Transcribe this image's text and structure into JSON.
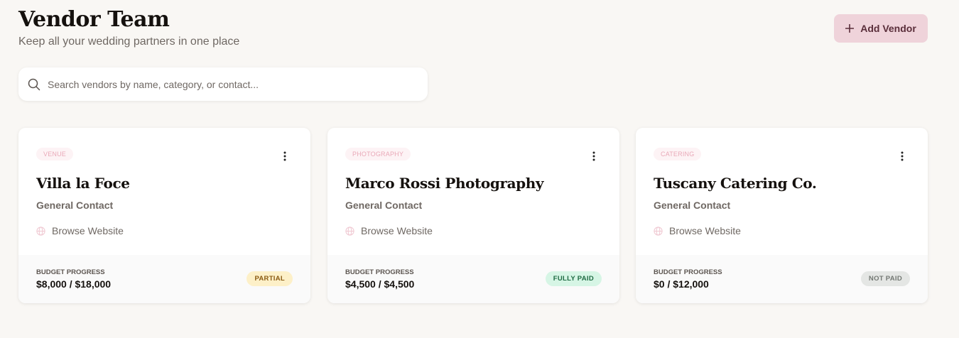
{
  "header": {
    "title": "Vendor Team",
    "subtitle": "Keep all your wedding partners in one place",
    "add_button_label": "Add Vendor",
    "add_button_icon": "plus-icon"
  },
  "search": {
    "placeholder": "Search vendors by name, category, or contact...",
    "value": "",
    "icon": "search-icon"
  },
  "vendors": [
    {
      "category": "VENUE",
      "name": "Villa la Foce",
      "contact": "General Contact",
      "website_label": "Browse Website",
      "budget_label": "BUDGET PROGRESS",
      "budget_value": "$8,000 / $18,000",
      "status": "PARTIAL",
      "status_bg": "#fdf0c8",
      "status_color": "#8a5a12"
    },
    {
      "category": "PHOTOGRAPHY",
      "name": "Marco Rossi Photography",
      "contact": "General Contact",
      "website_label": "Browse Website",
      "budget_label": "BUDGET PROGRESS",
      "budget_value": "$4,500 / $4,500",
      "status": "FULLY PAID",
      "status_bg": "#d6f5e5",
      "status_color": "#1f6b43"
    },
    {
      "category": "CATERING",
      "name": "Tuscany Catering Co.",
      "contact": "General Contact",
      "website_label": "Browse Website",
      "budget_label": "BUDGET PROGRESS",
      "budget_value": "$0 / $12,000",
      "status": "NOT PAID",
      "status_bg": "#e4e6e4",
      "status_color": "#737873"
    }
  ],
  "colors": {
    "background": "#f9f7f4",
    "accent": "#efd3da",
    "accent_text": "#5a2e3a",
    "category_tag_text": "#e9a9b8"
  }
}
